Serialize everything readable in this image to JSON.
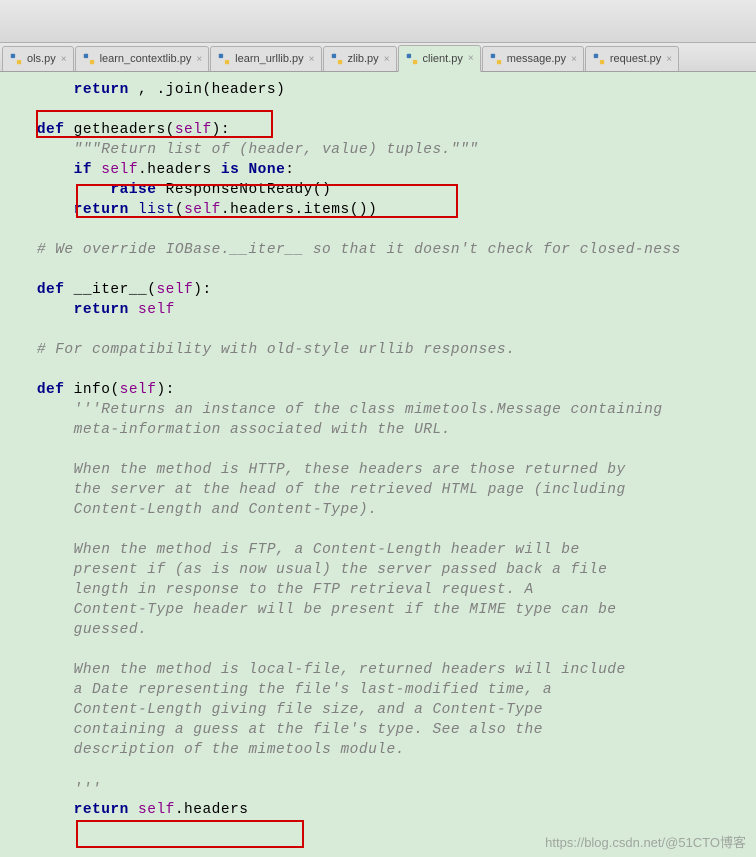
{
  "tabs": [
    {
      "label": "ols.py",
      "active": false
    },
    {
      "label": "learn_contextlib.py",
      "active": false
    },
    {
      "label": "learn_urllib.py",
      "active": false
    },
    {
      "label": "zlib.py",
      "active": false
    },
    {
      "label": "client.py",
      "active": true
    },
    {
      "label": "message.py",
      "active": false
    },
    {
      "label": "request.py",
      "active": false
    }
  ],
  "code": {
    "l1a": "        ",
    "l1_kw": "return",
    "l1b": " , .join(headers)",
    "l2": "",
    "l3a": "    ",
    "l3_def": "def",
    "l3b": " ",
    "l3_fn": "getheaders",
    "l3c": "(",
    "l3_self": "self",
    "l3d": "):",
    "l4a": "        ",
    "l4_str": "\"\"\"Return list of (header, value) tuples.\"\"\"",
    "l5a": "        ",
    "l5_if": "if",
    "l5b": " ",
    "l5_self": "self",
    "l5c": ".headers ",
    "l5_is": "is",
    "l5d": " ",
    "l5_none": "None",
    "l5e": ":",
    "l6a": "            ",
    "l6_raise": "raise",
    "l6b": " ResponseNotReady()",
    "l7a": "        ",
    "l7_ret": "return",
    "l7b": " ",
    "l7_list": "list",
    "l7c": "(",
    "l7_self": "self",
    "l7d": ".headers.items())",
    "l8": "",
    "l9a": "    ",
    "l9_c": "# We override IOBase.__iter__ so that it doesn't check for closed-ness",
    "l10": "",
    "l11a": "    ",
    "l11_def": "def",
    "l11b": " ",
    "l11_fn": "__iter__",
    "l11c": "(",
    "l11_self": "self",
    "l11d": "):",
    "l12a": "        ",
    "l12_ret": "return",
    "l12b": " ",
    "l12_self": "self",
    "l13": "",
    "l14a": "    ",
    "l14_c": "# For compatibility with old-style urllib responses.",
    "l15": "",
    "l16a": "    ",
    "l16_def": "def",
    "l16b": " ",
    "l16_fn": "info",
    "l16c": "(",
    "l16_self": "self",
    "l16d": "):",
    "l17a": "        ",
    "l17_s": "'''Returns an instance of the class mimetools.Message containing",
    "l18a": "        ",
    "l18_s": "meta-information associated with the URL.",
    "l19": "",
    "l20a": "        ",
    "l20_s": "When the method is HTTP, these headers are those returned by",
    "l21a": "        ",
    "l21_s": "the server at the head of the retrieved HTML page (including",
    "l22a": "        ",
    "l22_s": "Content-Length and Content-Type).",
    "l23": "",
    "l24a": "        ",
    "l24_s": "When the method is FTP, a Content-Length header will be",
    "l25a": "        ",
    "l25_s": "present if (as is now usual) the server passed back a file",
    "l26a": "        ",
    "l26_s": "length in response to the FTP retrieval request. A",
    "l27a": "        ",
    "l27_s": "Content-Type header will be present if the MIME type can be",
    "l28a": "        ",
    "l28_s": "guessed.",
    "l29": "",
    "l30a": "        ",
    "l30_s": "When the method is local-file, returned headers will include",
    "l31a": "        ",
    "l31_s": "a Date representing the file's last-modified time, a",
    "l32a": "        ",
    "l32_s": "Content-Length giving file size, and a Content-Type",
    "l33a": "        ",
    "l33_s": "containing a guess at the file's type. See also the",
    "l34a": "        ",
    "l34_s": "description of the mimetools module.",
    "l35": "",
    "l36a": "        ",
    "l36_s": "'''",
    "l37a": "        ",
    "l37_ret": "return",
    "l37b": " ",
    "l37_self": "self",
    "l37c": ".headers"
  },
  "watermark": "https://blog.csdn.net/@51CTO博客"
}
